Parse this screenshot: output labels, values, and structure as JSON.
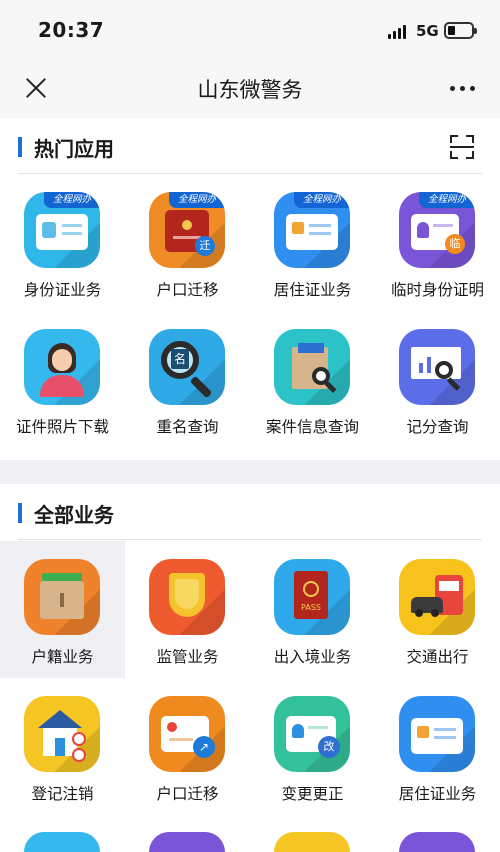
{
  "status_bar": {
    "time": "20:37",
    "network": "5G"
  },
  "nav": {
    "title": "山东微警务"
  },
  "hot_apps": {
    "title": "热门应用",
    "items": [
      {
        "label": "身份证业务",
        "badge": "全程网办",
        "icon": "id-card-icon",
        "color": "#2fb6ea"
      },
      {
        "label": "户口迁移",
        "badge": "全程网办",
        "icon": "household-book-icon",
        "color": "#f08c25"
      },
      {
        "label": "居住证业务",
        "badge": "全程网办",
        "icon": "residence-card-icon",
        "color": "#2f8ff0"
      },
      {
        "label": "临时身份证明",
        "badge": "全程网办",
        "icon": "temp-id-icon",
        "color": "#7a55d8"
      },
      {
        "label": "证件照片下载",
        "icon": "id-photo-icon",
        "color": "#35b8ee"
      },
      {
        "label": "重名查询",
        "icon": "name-search-icon",
        "color": "#2fa8e6"
      },
      {
        "label": "案件信息查询",
        "icon": "case-search-icon",
        "color": "#2bc2c8"
      },
      {
        "label": "记分查询",
        "icon": "score-search-icon",
        "color": "#5b6ee8"
      }
    ]
  },
  "all_services": {
    "title": "全部业务",
    "items": [
      {
        "label": "户籍业务",
        "icon": "household-register-icon",
        "color": "#f0822c"
      },
      {
        "label": "监管业务",
        "icon": "shield-icon",
        "color": "#ef5a2f"
      },
      {
        "label": "出入境业务",
        "icon": "passport-icon",
        "color": "#30a8ec"
      },
      {
        "label": "交通出行",
        "icon": "traffic-icon",
        "color": "#f7c21c"
      },
      {
        "label": "登记注销",
        "icon": "house-register-icon",
        "color": "#f5c623"
      },
      {
        "label": "户口迁移",
        "icon": "household-transfer-icon",
        "color": "#ef8a1f"
      },
      {
        "label": "变更更正",
        "icon": "change-correct-icon",
        "color": "#33c19a"
      },
      {
        "label": "居住证业务",
        "icon": "residence-card-icon",
        "color": "#2f8ff0"
      }
    ]
  }
}
